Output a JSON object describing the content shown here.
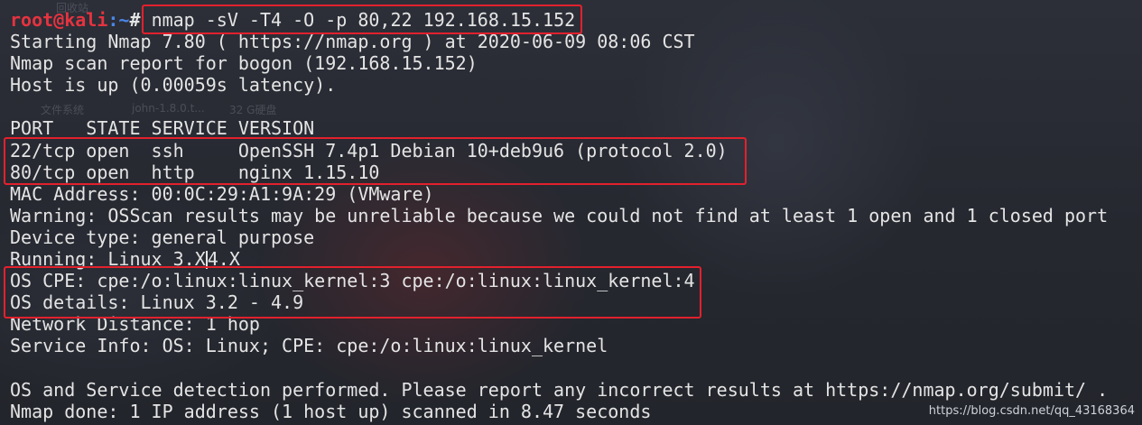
{
  "prompt": {
    "user": "root@kali",
    "path": ":~",
    "symbol": "# ",
    "command": "nmap -sV -T4 -O -p 80,22 192.168.15.152"
  },
  "output": [
    "Starting Nmap 7.80 ( https://nmap.org ) at 2020-06-09 08:06 CST",
    "Nmap scan report for bogon (192.168.15.152)",
    "Host is up (0.00059s latency).",
    "",
    "PORT   STATE SERVICE VERSION",
    "22/tcp open  ssh     OpenSSH 7.4p1 Debian 10+deb9u6 (protocol 2.0)",
    "80/tcp open  http    nginx 1.15.10",
    "MAC Address: 00:0C:29:A1:9A:29 (VMware)",
    "Warning: OSScan results may be unreliable because we could not find at least 1 open and 1 closed port",
    "Device type: general purpose",
    "Running: Linux 3.X",
    "OS CPE: cpe:/o:linux:linux_kernel:3 cpe:/o:linux:linux_kernel:4",
    "OS details: Linux 3.2 - 4.9",
    "Network Distance: 1 hop",
    "Service Info: OS: Linux; CPE: cpe:/o:linux:linux_kernel",
    "",
    "OS and Service detection performed. Please report any incorrect results at https://nmap.org/submit/ .",
    "Nmap done: 1 IP address (1 host up) scanned in 8.47 seconds"
  ],
  "running_suffix": "4.X",
  "background_text": {
    "folder_label": "回收站",
    "file_system": "文件系统",
    "john": "john-1.8.0.t...",
    "size": "32 G硬盘"
  },
  "watermark": "https://blog.csdn.net/qq_43168364",
  "colors": {
    "prompt_user": "#e5333f",
    "prompt_path": "#4a86e8",
    "highlight_box": "#e2212d",
    "text": "#e4e4e4"
  }
}
